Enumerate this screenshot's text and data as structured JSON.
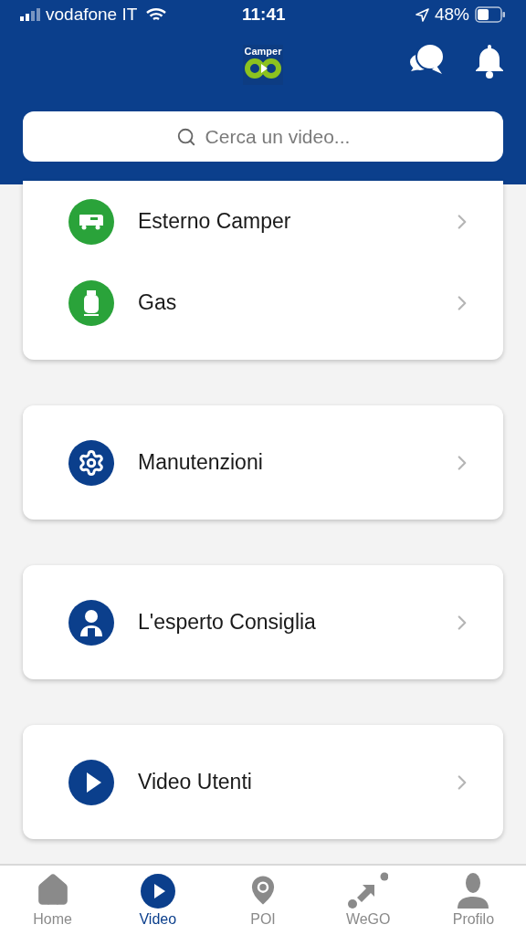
{
  "status_bar": {
    "carrier": "vodafone IT",
    "time": "11:41",
    "battery": "48%"
  },
  "header": {
    "logo_text": "Camper",
    "search": {
      "placeholder": "Cerca un video..."
    }
  },
  "sections": [
    {
      "items": [
        {
          "label": "Esterno Camper",
          "kind": "camper",
          "color": "#2aa33a"
        },
        {
          "label": "Gas",
          "kind": "gas",
          "color": "#2aa33a"
        }
      ]
    },
    {
      "items": [
        {
          "label": "Manutenzioni",
          "kind": "gear",
          "color": "#0b3f8c"
        }
      ]
    },
    {
      "items": [
        {
          "label": "L'esperto Consiglia",
          "kind": "expert",
          "color": "#0b3f8c"
        }
      ]
    },
    {
      "items": [
        {
          "label": "Video Utenti",
          "kind": "play",
          "color": "#0b3f8c"
        }
      ]
    }
  ],
  "tab_bar": [
    {
      "label": "Home",
      "kind": "home",
      "selected": false
    },
    {
      "label": "Video",
      "kind": "video",
      "selected": true
    },
    {
      "label": "POI",
      "kind": "pin",
      "selected": false
    },
    {
      "label": "WeGO",
      "kind": "wego",
      "selected": false
    },
    {
      "label": "Profilo",
      "kind": "profile",
      "selected": false
    }
  ]
}
